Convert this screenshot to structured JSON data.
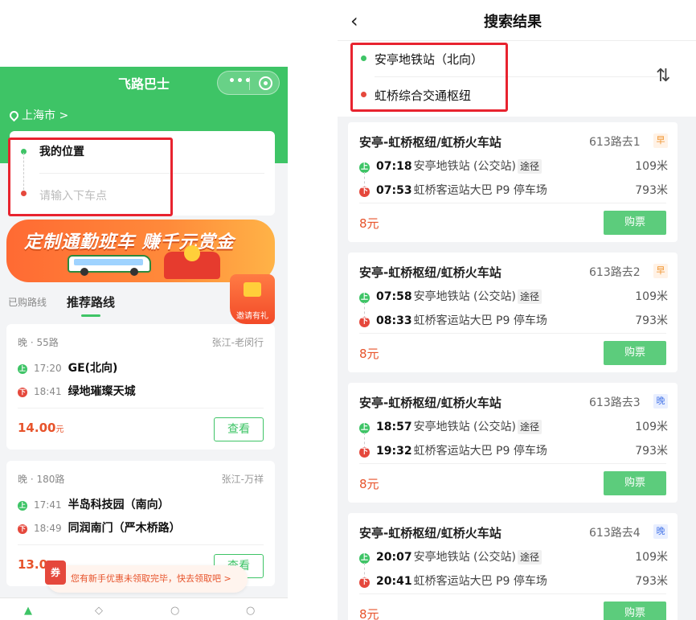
{
  "left": {
    "app_title": "飞路巴士",
    "capsule_more": "•••",
    "city": "上海市 >",
    "search": {
      "from_label": "我的位置",
      "to_placeholder": "请输入下车点"
    },
    "banner": {
      "headline": "定制通勤班车 赚千元赏金",
      "invite_label": "邀请有礼"
    },
    "tabs": {
      "purchased": "已购路线",
      "recommended": "推荐路线"
    },
    "cards": [
      {
        "route": "晚 · 55路",
        "area": "张江-老闵行",
        "board_time": "17:20",
        "board_stop": "GE(北向)",
        "alight_time": "18:41",
        "alight_stop": "绿地璀璨天城",
        "price": "14.00",
        "price_unit": "元",
        "view_label": "查看"
      },
      {
        "route": "晚 · 180路",
        "area": "张江-万祥",
        "board_time": "17:41",
        "board_stop": "半岛科技园（南向）",
        "alight_time": "18:49",
        "alight_stop": "同润南门（严木桥路）",
        "price": "13.0",
        "price_unit": "",
        "view_label": "查看"
      }
    ],
    "toast": {
      "badge": "券",
      "text": "您有新手优惠未领取完毕，快去领取吧 >"
    }
  },
  "right": {
    "page_title": "搜索结果",
    "back_icon": "chevron-left-icon",
    "from_stop": "安亭地铁站（北向）",
    "to_stop": "虹桥综合交通枢纽",
    "swap_icon": "swap-icon",
    "results": [
      {
        "line_name": "安亭-虹桥枢纽/虹桥火车站",
        "route_no": "613路去1",
        "tag": "早",
        "tag_type": "early",
        "board_time": "07:18",
        "board_stop": "安亭地铁站 (公交站)",
        "via_label": "途径",
        "board_dist": "109米",
        "alight_time": "07:53",
        "alight_stop": "虹桥客运站大巴 P9 停车场",
        "alight_dist": "793米",
        "price": "8元",
        "buy_label": "购票"
      },
      {
        "line_name": "安亭-虹桥枢纽/虹桥火车站",
        "route_no": "613路去2",
        "tag": "早",
        "tag_type": "early",
        "board_time": "07:58",
        "board_stop": "安亭地铁站 (公交站)",
        "via_label": "途径",
        "board_dist": "109米",
        "alight_time": "08:33",
        "alight_stop": "虹桥客运站大巴 P9 停车场",
        "alight_dist": "793米",
        "price": "8元",
        "buy_label": "购票"
      },
      {
        "line_name": "安亭-虹桥枢纽/虹桥火车站",
        "route_no": "613路去3",
        "tag": "晚",
        "tag_type": "late",
        "board_time": "18:57",
        "board_stop": "安亭地铁站 (公交站)",
        "via_label": "途径",
        "board_dist": "109米",
        "alight_time": "19:32",
        "alight_stop": "虹桥客运站大巴 P9 停车场",
        "alight_dist": "793米",
        "price": "8元",
        "buy_label": "购票"
      },
      {
        "line_name": "安亭-虹桥枢纽/虹桥火车站",
        "route_no": "613路去4",
        "tag": "晚",
        "tag_type": "late",
        "board_time": "20:07",
        "board_stop": "安亭地铁站 (公交站)",
        "via_label": "途径",
        "board_dist": "109米",
        "alight_time": "20:41",
        "alight_stop": "虹桥客运站大巴 P9 停车场",
        "alight_dist": "793米",
        "price": "8元",
        "buy_label": "购票"
      }
    ]
  },
  "colors": {
    "brand_green": "#3ec466",
    "price_orange": "#e7532b",
    "highlight_red": "#e8232f"
  }
}
